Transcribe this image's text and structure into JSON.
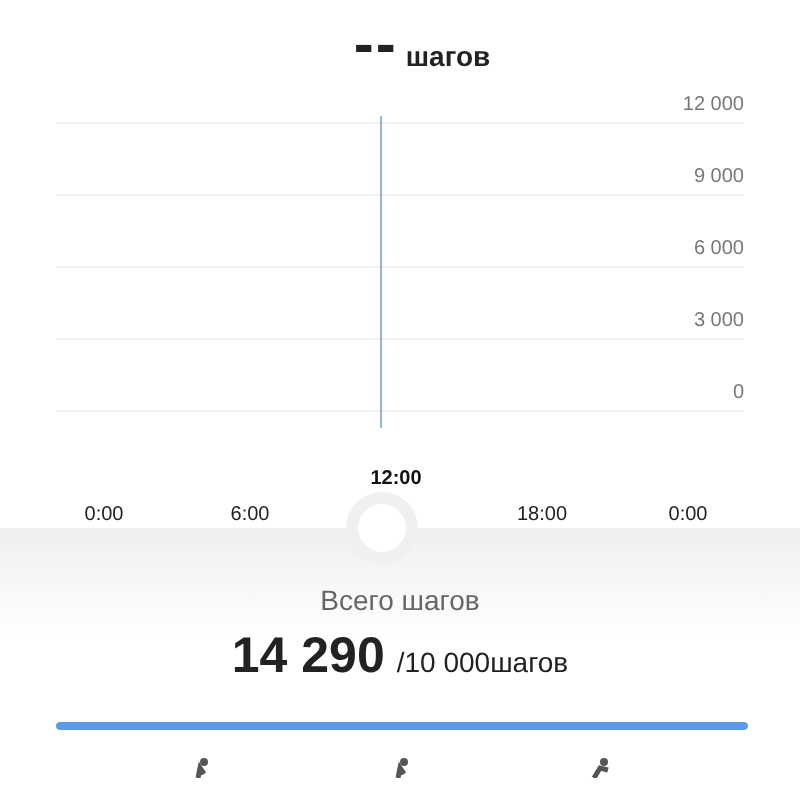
{
  "header": {
    "value": "--",
    "unit": "шагов"
  },
  "chart": {
    "y_labels": [
      "12 000",
      "9 000",
      "6 000",
      "3 000",
      "0"
    ],
    "x_labels": [
      {
        "label": "0:00",
        "selected": false
      },
      {
        "label": "6:00",
        "selected": false
      },
      {
        "label": "12:00",
        "selected": true
      },
      {
        "label": "18:00",
        "selected": false
      },
      {
        "label": "0:00",
        "selected": false
      }
    ]
  },
  "summary": {
    "title": "Всего шагов",
    "total": "14 290",
    "goal": "/10 000шагов",
    "level": 1
  },
  "activities": [
    {
      "kind": "walk"
    },
    {
      "kind": "walk"
    },
    {
      "kind": "run"
    }
  ]
}
